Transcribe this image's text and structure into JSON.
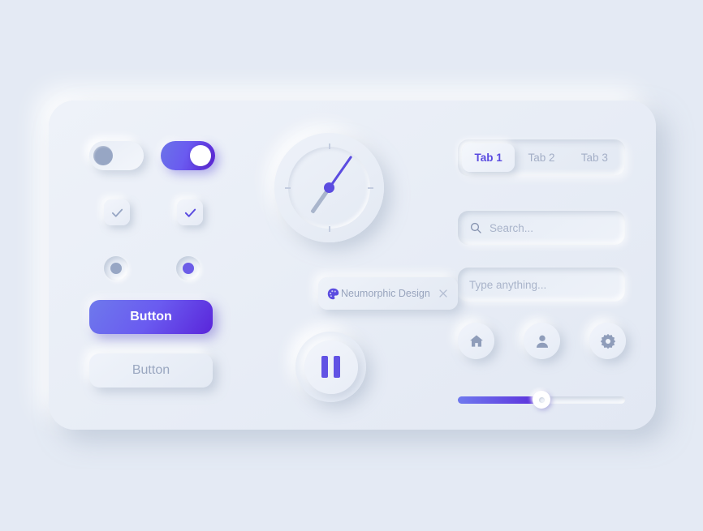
{
  "theme": {
    "page_background": "#e4eaf4",
    "card_background": "#eaeff7",
    "accent_purple": "#6c5ce7",
    "accent_purple_deep": "#5b21d6",
    "muted_text": "#9aa7c0",
    "gray_control": "#97a6c4"
  },
  "controls": {
    "toggles": [
      {
        "name": "toggle-off",
        "state": "off",
        "icon": "toggle-knob"
      },
      {
        "name": "toggle-on",
        "state": "on",
        "icon": "toggle-knob"
      }
    ],
    "checkboxes": [
      {
        "name": "checkbox-gray",
        "checked": true,
        "check_color": "#97a6c4",
        "icon": "check-icon"
      },
      {
        "name": "checkbox-purple",
        "checked": true,
        "check_color": "#5b4ce0",
        "icon": "check-icon"
      }
    ],
    "radios": [
      {
        "name": "radio-gray",
        "selected": true,
        "dot_color": "#97a6c4"
      },
      {
        "name": "radio-purple",
        "selected": true,
        "dot_color": "#6c5ce7"
      }
    ],
    "buttons": {
      "primary_label": "Button",
      "secondary_label": "Button"
    }
  },
  "clock": {
    "minute_hand_degrees": 35,
    "hour_hand_degrees": 215,
    "minute_hand_color": "#5b4ce0",
    "hour_hand_color": "#a9b5cc",
    "ticks": [
      "12",
      "3",
      "6",
      "9"
    ]
  },
  "chip": {
    "label": "Neumorphic Design",
    "palette_icon": "palette-icon",
    "close_icon": "close-icon"
  },
  "media": {
    "pause_icon": "pause-icon",
    "state": "playing"
  },
  "tabs": {
    "active_index": 0,
    "items": [
      {
        "label": "Tab 1"
      },
      {
        "label": "Tab 2"
      },
      {
        "label": "Tab 3"
      }
    ]
  },
  "inputs": {
    "search": {
      "icon": "search-icon",
      "placeholder": "Search...",
      "value": ""
    },
    "text": {
      "placeholder": "Type anything...",
      "value": ""
    }
  },
  "icon_buttons": [
    {
      "name": "home",
      "icon": "home-icon"
    },
    {
      "name": "user",
      "icon": "user-icon"
    },
    {
      "name": "settings",
      "icon": "gear-icon"
    }
  ],
  "slider": {
    "value": 50,
    "min": 0,
    "max": 100,
    "fill_color": "#5b2ddb"
  }
}
